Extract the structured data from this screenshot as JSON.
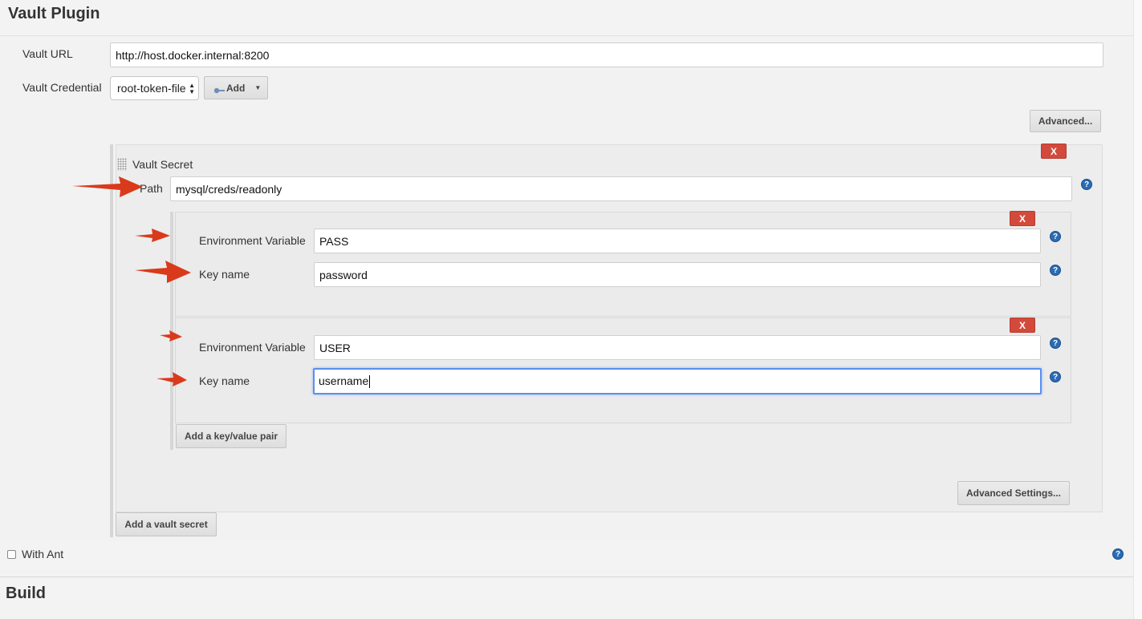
{
  "vault_plugin": {
    "title": "Vault Plugin",
    "url_label": "Vault URL",
    "url_value": "http://host.docker.internal:8200",
    "credential_label": "Vault Credential",
    "credential_selected": "root-token-file",
    "add_label": "Add",
    "advanced_label": "Advanced..."
  },
  "vault_secret": {
    "title": "Vault Secret",
    "path_label": "Path",
    "path_value": "mysql/creds/readonly",
    "delete_label": "X",
    "pairs": [
      {
        "env_label": "Environment Variable",
        "env_value": "PASS",
        "key_label": "Key name",
        "key_value": "password",
        "delete_label": "X"
      },
      {
        "env_label": "Environment Variable",
        "env_value": "USER",
        "key_label": "Key name",
        "key_value": "username",
        "delete_label": "X"
      }
    ],
    "add_pair_label": "Add a key/value pair",
    "advanced_settings_label": "Advanced Settings..."
  },
  "add_vault_secret_label": "Add a vault secret",
  "with_ant": {
    "label": "With Ant",
    "checked": false
  },
  "build": {
    "title": "Build"
  },
  "help_glyph": "?",
  "colors": {
    "annotation_arrow": "#d93a1c",
    "delete_button": "#d24a3c",
    "help_icon": "#2a6bb5",
    "focus_ring": "#5b8ef0"
  }
}
